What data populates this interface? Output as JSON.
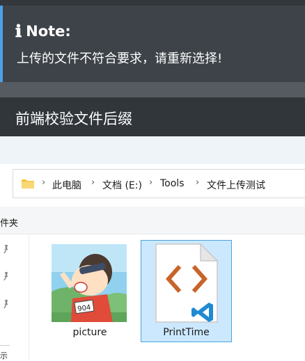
{
  "note": {
    "icon": "info-icon",
    "title": "Note:",
    "message": "上传的文件不符合要求，请重新选择!"
  },
  "section": {
    "title": "前端校验文件后缀"
  },
  "address_bar": {
    "icon": "folder-icon",
    "crumbs": [
      "此电脑",
      "文档 (E:)",
      "Tools",
      "文件上传测试"
    ]
  },
  "tab": {
    "label": "件夹"
  },
  "nav": {
    "bottom_text": "示"
  },
  "files": [
    {
      "name": "picture",
      "icon": "image-thumbnail",
      "selected": false
    },
    {
      "name": "PrintTime",
      "icon": "code-file-icon",
      "selected": true
    }
  ],
  "colors": {
    "note_bg": "#3d4349",
    "note_accent": "#4ea1e6",
    "section_bg": "#31363b",
    "selection_bg": "#cce8ff",
    "selection_border": "#4aa3df",
    "code_orange": "#c8642a",
    "vscode_blue": "#1f8ad2"
  }
}
